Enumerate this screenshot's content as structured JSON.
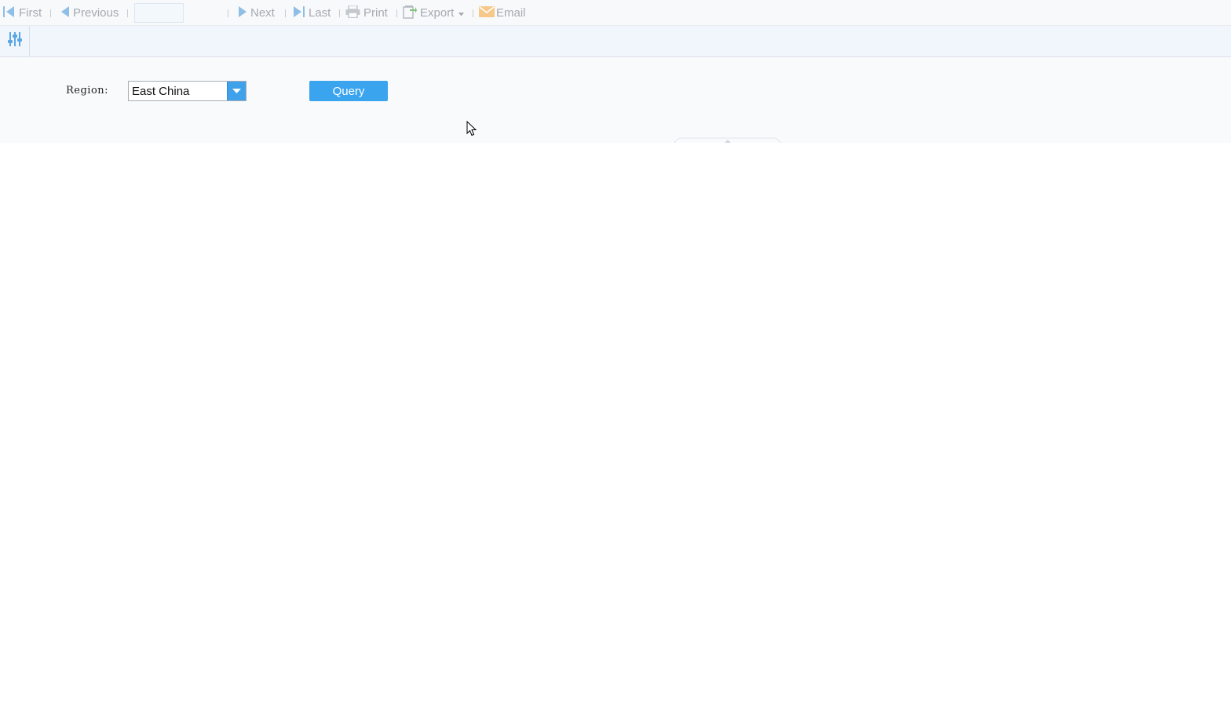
{
  "toolbar": {
    "first_label": "First",
    "previous_label": "Previous",
    "page_value": "",
    "next_label": "Next",
    "last_label": "Last",
    "print_label": "Print",
    "export_label": "Export",
    "email_label": "Email"
  },
  "params": {
    "region_label": "Region:",
    "region_value": "East China",
    "query_label": "Query"
  },
  "icons": {
    "first": "first-page-icon",
    "previous": "previous-page-icon",
    "next": "next-page-icon",
    "last": "last-page-icon",
    "print": "printer-icon",
    "export": "export-icon",
    "email": "envelope-icon",
    "filter": "sliders-icon",
    "dropdown": "chevron-down-icon"
  },
  "colors": {
    "accent": "#3aa4ef",
    "toolbar_text": "#a5aab1",
    "nav_icon": "#8fbfe6",
    "email_icon": "#f6c98a"
  }
}
